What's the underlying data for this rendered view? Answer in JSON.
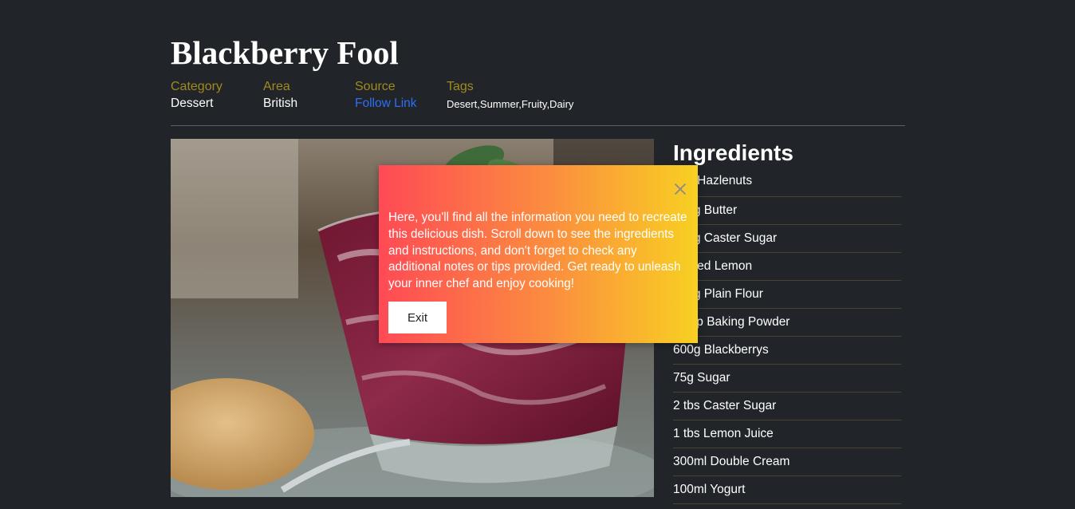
{
  "recipe": {
    "title": "Blackberry Fool",
    "meta": {
      "category_label": "Category",
      "category_value": "Dessert",
      "area_label": "Area",
      "area_value": "British",
      "source_label": "Source",
      "source_link": "Follow Link",
      "tags_label": "Tags",
      "tags_value": "Desert,Summer,Fruity,Dairy"
    },
    "image_subject": "blackberry fool dessert in glass with mint and biscuit"
  },
  "ingredients": {
    "title": "Ingredients",
    "items": [
      "50g Hazlenuts",
      "125g Butter",
      "150g Caster Sugar",
      "Grated Lemon",
      "150g Plain Flour",
      "½ tsp Baking Powder",
      "600g Blackberrys",
      "75g Sugar",
      "2 tbs Caster Sugar",
      "1 tbs Lemon Juice",
      "300ml Double Cream",
      "100ml Yogurt"
    ]
  },
  "modal": {
    "text": "Here, you'll find all the information you need to recreate this delicious dish. Scroll down to see the ingredients and instructions, and don't forget to check any additional notes or tips provided. Get ready to unleash your inner chef and enjoy cooking!",
    "exit_label": "Exit",
    "close_icon": "close-icon",
    "gradient_start": "#ff4a55",
    "gradient_end": "#f8d022"
  },
  "colors": {
    "background": "#212529",
    "meta_label": "#a08a1e",
    "link": "#2f6df6"
  }
}
